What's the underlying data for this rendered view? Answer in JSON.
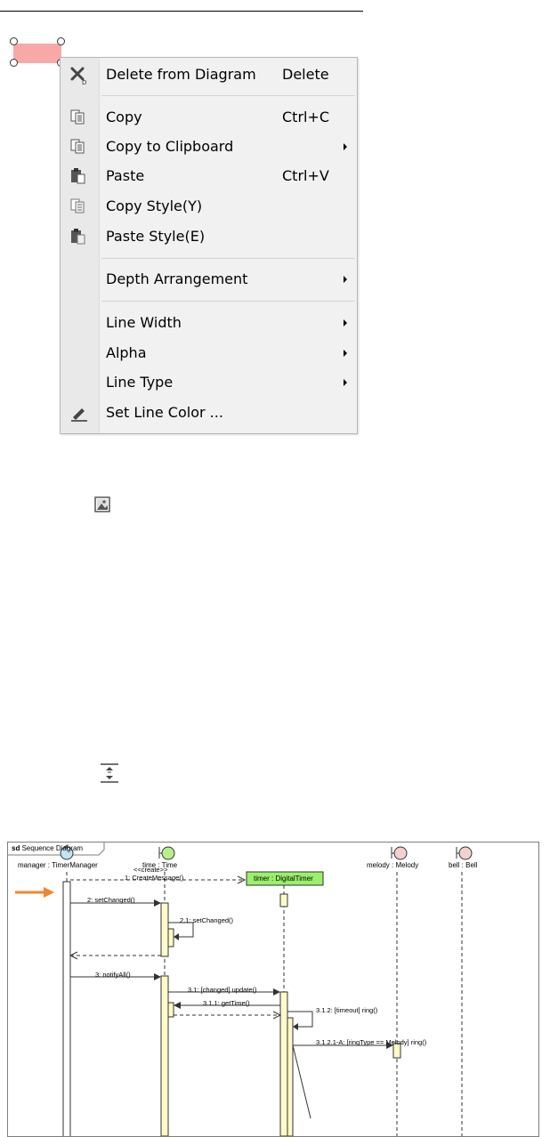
{
  "context_menu": {
    "items": [
      {
        "label": "Delete from Diagram",
        "shortcut": "Delete",
        "icon": "delete-x-icon",
        "submenu": false
      },
      {
        "label": "Copy",
        "shortcut": "Ctrl+C",
        "icon": "copy-icon",
        "submenu": false
      },
      {
        "label": "Copy to Clipboard",
        "shortcut": "",
        "icon": "copy-clipboard-icon",
        "submenu": true
      },
      {
        "label": "Paste",
        "shortcut": "Ctrl+V",
        "icon": "paste-icon",
        "submenu": false
      },
      {
        "label": "Copy Style(Y)",
        "shortcut": "",
        "icon": "copy-style-icon",
        "submenu": false
      },
      {
        "label": "Paste Style(E)",
        "shortcut": "",
        "icon": "paste-style-icon",
        "submenu": false
      },
      {
        "label": "Depth Arrangement",
        "shortcut": "",
        "icon": "",
        "submenu": true
      },
      {
        "label": "Line Width",
        "shortcut": "",
        "icon": "",
        "submenu": true
      },
      {
        "label": "Alpha",
        "shortcut": "",
        "icon": "",
        "submenu": true
      },
      {
        "label": "Line Type",
        "shortcut": "",
        "icon": "",
        "submenu": true
      },
      {
        "label": "Set Line Color ...",
        "shortcut": "",
        "icon": "pencil-icon",
        "submenu": false
      }
    ]
  },
  "icons": {
    "picture": "picture-icon",
    "arrange": "vertical-spacing-icon"
  },
  "sequence_diagram": {
    "frame_keyword": "sd",
    "frame_title": "Sequence Diagram",
    "lifelines": [
      {
        "label": "manager : TimerManager",
        "kind": "control",
        "color": "#bfe3f5"
      },
      {
        "label": "time : Time",
        "kind": "boundary",
        "color": "#b6ef8c"
      },
      {
        "label": "timer : DigitalTimer",
        "kind": "created-object",
        "color": "#9af06a"
      },
      {
        "label": "melody : Melody",
        "kind": "boundary",
        "color": "#f6d0d0"
      },
      {
        "label": "bell : Bell",
        "kind": "boundary",
        "color": "#f6d0d0"
      }
    ],
    "messages": [
      {
        "label": "<<create>>"
      },
      {
        "label": "1: CreateMessage()"
      },
      {
        "label": "2: setChanged()"
      },
      {
        "label": "2.1: setChanged()"
      },
      {
        "label": "3: notifyAll()"
      },
      {
        "label": "3.1: [changed] update()"
      },
      {
        "label": "3.1.1: getTime()"
      },
      {
        "label": "3.1.2: [timeout] ring()"
      },
      {
        "label": "3.1.2.1-A: [ringType == Melody] ring()"
      }
    ],
    "accent_color": "#f08530"
  }
}
